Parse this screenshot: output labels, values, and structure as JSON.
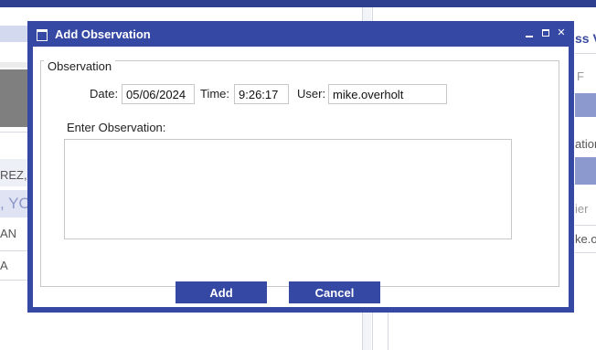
{
  "background": {
    "left_rows": [
      "REZ, J",
      ", YO",
      "AN",
      "A"
    ],
    "right_header": "ss V",
    "right_rows": [
      "F",
      "ation",
      "ier",
      "ke.ove"
    ]
  },
  "dialog": {
    "title": "Add Observation",
    "window_controls": {
      "minimize": "",
      "maximize": "",
      "close": "✕"
    },
    "fieldset_legend": "Observation",
    "date": {
      "label": "Date:",
      "value": "05/06/2024"
    },
    "time": {
      "label": "Time:",
      "value": "9:26:17"
    },
    "user": {
      "label": "User:",
      "value": "mike.overholt"
    },
    "observation": {
      "label": "Enter Observation:",
      "value": ""
    },
    "buttons": {
      "add": "Add",
      "cancel": "Cancel"
    }
  },
  "colors": {
    "dialog_frame": "#3548a4",
    "button_bg": "#3548a4",
    "topbar": "#2f3f8f"
  },
  "icons": {
    "title_icon": "window-icon",
    "minimize": "minimize-icon",
    "maximize": "maximize-icon",
    "close": "close-icon"
  }
}
